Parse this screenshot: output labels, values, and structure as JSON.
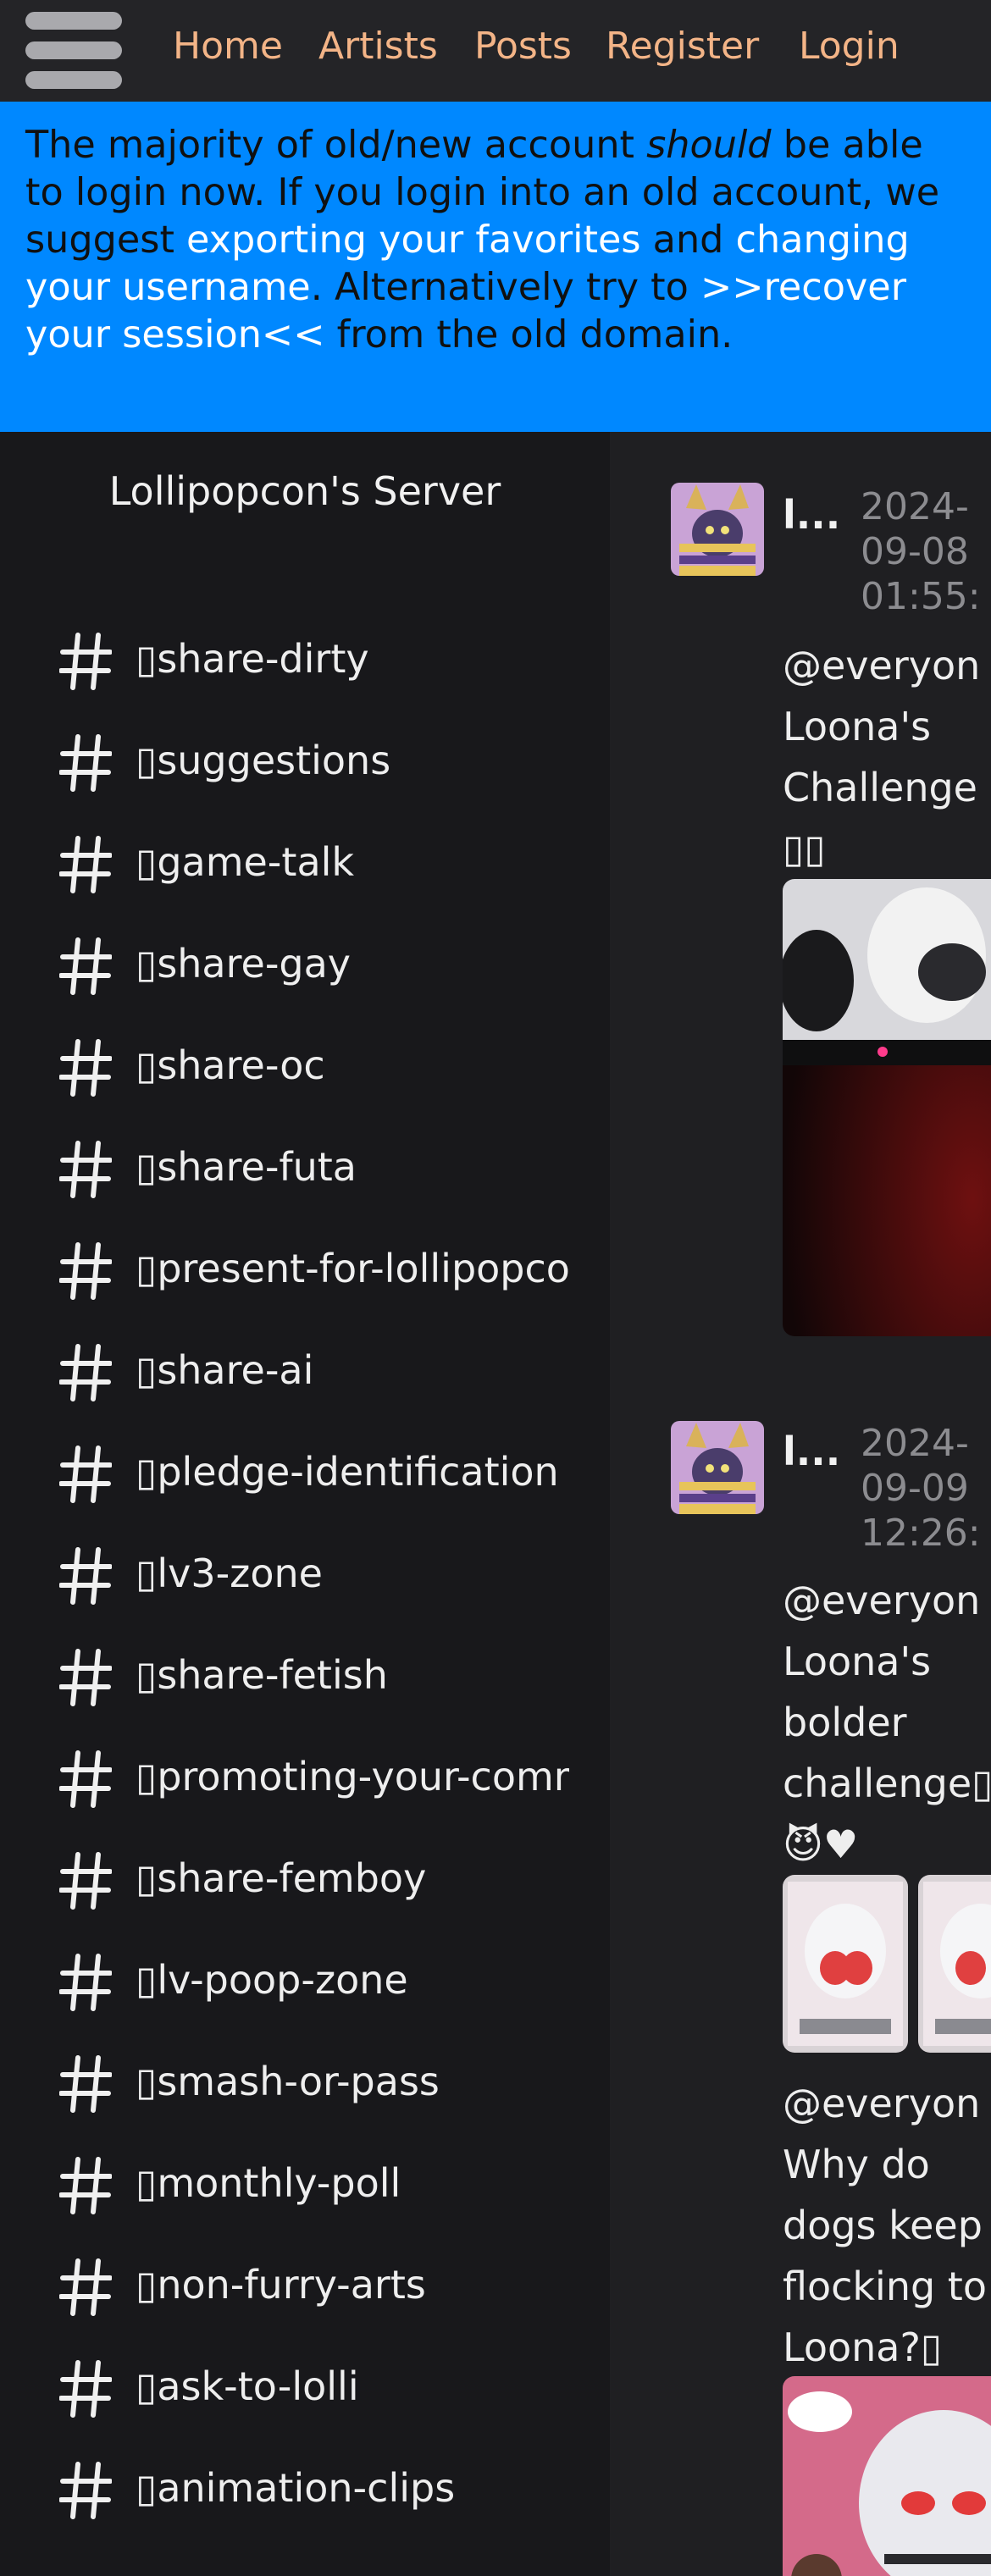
{
  "nav": {
    "menu_icon": "hamburger-icon",
    "links": [
      "Home",
      "Artists",
      "Posts",
      "Register",
      "Login"
    ]
  },
  "banner": {
    "text_1": "The majority of old/new account ",
    "text_em": "should",
    "text_2": " be able to login now. If you login into an old account, we suggest ",
    "link_export": "exporting your favorites",
    "text_3": " and ",
    "link_username": "changing your username",
    "text_4": ". Alternatively try to ",
    "link_recover": ">>recover your session<<",
    "text_5": " from the old domain."
  },
  "sidebar": {
    "server_name": "Lollipopcon's Server",
    "channel_icon": "hash-icon",
    "channels": [
      "▯share-dirty",
      "▯suggestions",
      "▯game-talk",
      "▯share-gay",
      "▯share-oc",
      "▯share-futa",
      "▯present-for-lollipopcon",
      "▯share-ai",
      "▯pledge-identification",
      "▯lv3-zone",
      "▯share-fetish",
      "▯promoting-your-commissions",
      "▯share-femboy",
      "▯lv-poop-zone",
      "▯smash-or-pass",
      "▯monthly-poll",
      "▯non-furry-arts",
      "▯ask-to-lolli",
      "▯animation-clips"
    ]
  },
  "posts": [
    {
      "author": "l...",
      "timestamp": "2024-\n09-08\n01:55:",
      "messages": [
        "@everyon\nLoona's\nChallenge\n▯▯"
      ]
    },
    {
      "author": "l...",
      "timestamp": "2024-\n09-09\n12:26:",
      "messages": [
        "@everyon\nLoona's\nbolder\nchallenge▯\n😈♥",
        "@everyon\nWhy do\ndogs keep\nflocking to\nLoona?▯"
      ]
    }
  ]
}
